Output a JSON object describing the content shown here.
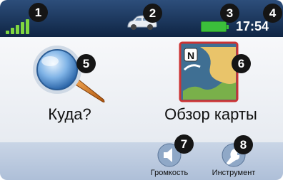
{
  "statusbar": {
    "signal_icon": "gps-signal-icon",
    "vehicle_icon": "car-icon",
    "battery_icon": "battery-icon",
    "time": "17:54"
  },
  "menu": {
    "where_to": {
      "label": "Куда?",
      "icon": "magnifier-icon"
    },
    "view_map": {
      "label": "Обзор карты",
      "icon": "map-icon"
    }
  },
  "bottombar": {
    "volume": {
      "label": "Громкость",
      "icon": "speaker-icon"
    },
    "tools": {
      "label": "Инструмент",
      "icon": "wrench-icon"
    }
  },
  "callouts": [
    "1",
    "2",
    "3",
    "4",
    "5",
    "6",
    "7",
    "8"
  ],
  "colors": {
    "statusbar": "#1b3558",
    "signal": "#7fd640",
    "battery": "#3bbf3b",
    "callout": "#151515"
  }
}
